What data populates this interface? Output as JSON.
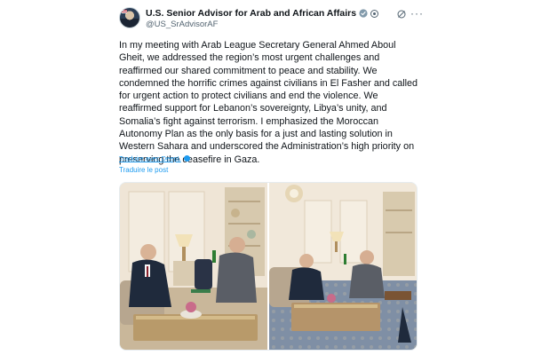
{
  "post": {
    "author": {
      "display_name": "U.S. Senior Advisor for Arab and African Affairs",
      "handle": "@US_SrAdvisorAF",
      "verified": true
    },
    "icons": [
      "verified-badge-icon",
      "affiliation-icon",
      "grok-icon",
      "more-icon"
    ],
    "body": "In my meeting with Arab League Secretary General Ahmed Aboul Gheit, we addressed the region’s most urgent challenges and reaffirmed our shared commitment to peace and stability. We condemned the horrific crimes against civilians in El Fasher and called for urgent action to protect civilians and end the violence. We reaffirmed support for Lebanon’s sovereignty, Libya’s unity, and Somalia’s fight against terrorism. I emphasized the Moroccan Autonomy Plan as the only basis for a just and lasting solution in Western Sahara and underscored the Administration’s high priority on preserving the ceasefire in Gaza.",
    "translated_with": "Traduire avec DeepL",
    "translate_post": "Traduire le post",
    "more_symbol": "···"
  },
  "colors": {
    "link": "#1d9bf0",
    "secondary_text": "#536471",
    "primary_text": "#0f1419"
  }
}
